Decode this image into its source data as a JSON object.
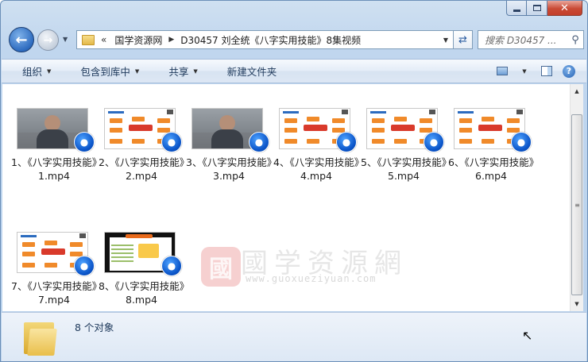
{
  "window": {
    "caption_buttons": {
      "minimize": "–",
      "maximize": "□",
      "close": "✕"
    }
  },
  "address_bar": {
    "chevron": "«",
    "segments": [
      "国学资源网",
      "D30457 刘全统《八字实用技能》8集视频"
    ],
    "search_placeholder": "搜索 D30457 ..."
  },
  "toolbar": {
    "organize": "组织",
    "include_in_library": "包含到库中",
    "share": "共享",
    "new_folder": "新建文件夹"
  },
  "files": [
    {
      "label": "1、《八字实用技能》1.mp4",
      "thumbnail": "video"
    },
    {
      "label": "2、《八字实用技能》2.mp4",
      "thumbnail": "slide"
    },
    {
      "label": "3、《八字实用技能》3.mp4",
      "thumbnail": "video"
    },
    {
      "label": "4、《八字实用技能》4.mp4",
      "thumbnail": "slide"
    },
    {
      "label": "5、《八字实用技能》5.mp4",
      "thumbnail": "slide"
    },
    {
      "label": "6、《八字实用技能》6.mp4",
      "thumbnail": "slide"
    },
    {
      "label": "7、《八字实用技能》7.mp4",
      "thumbnail": "slide"
    },
    {
      "label": "8、《八字实用技能》8.mp4",
      "thumbnail": "dark"
    }
  ],
  "watermark": {
    "logo": "國",
    "text": "國学资源網",
    "url": "www.guoxueziyuan.com"
  },
  "details": {
    "status": "8 个对象"
  },
  "colors": {
    "accent": "#2d6bbf",
    "badge": "#0b55c9",
    "chrome": "#c0d6ee"
  }
}
